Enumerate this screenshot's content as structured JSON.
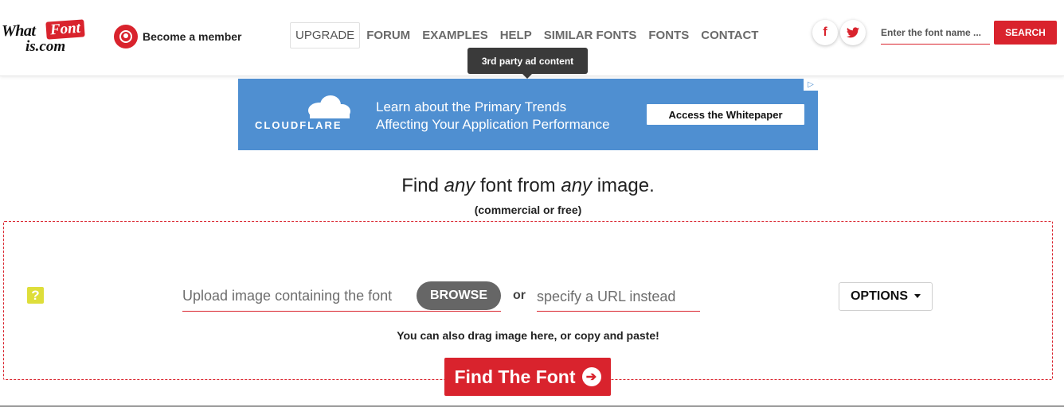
{
  "logo": {
    "part1": "What",
    "part2": "Font",
    "part3": "is.com"
  },
  "member": {
    "label": "Become a member"
  },
  "nav": {
    "items": [
      "UPGRADE",
      "FORUM",
      "EXAMPLES",
      "HELP",
      "SIMILAR FONTS",
      "FONTS",
      "CONTACT"
    ]
  },
  "social": {
    "facebook": "f",
    "twitter": "t"
  },
  "search": {
    "placeholder": "Enter the font name ...",
    "button": "SEARCH"
  },
  "tooltip": "3rd party ad content",
  "ad": {
    "brand": "CLOUDFLARE",
    "line1": "Learn about the Primary Trends",
    "line2": "Affecting Your Application Performance",
    "cta": "Access the Whitepaper",
    "adchoice": "▷"
  },
  "headline": {
    "w1": "Find ",
    "w2": "any",
    "w3": " font from ",
    "w4": "any",
    "w5": " image."
  },
  "subheadline": "(commercial or free)",
  "upload": {
    "help": "?",
    "placeholder": "Upload image containing the font",
    "browse": "BROWSE",
    "or": "or",
    "url_placeholder": "specify a URL instead",
    "options": "OPTIONS",
    "drag_hint": "You can also drag image here, or copy and paste!",
    "find": "Find The Font",
    "find_icon": "➔"
  },
  "colors": {
    "accent": "#d9232d",
    "ad_bg": "#4f8fd1",
    "help": "#dede3a"
  }
}
